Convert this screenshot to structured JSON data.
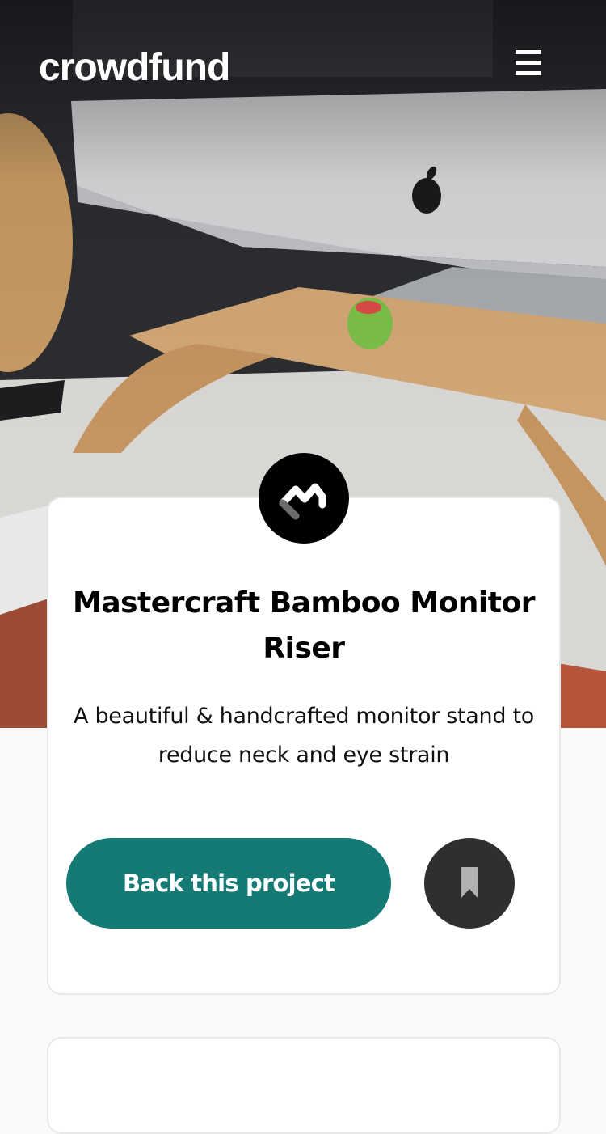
{
  "header": {
    "logo_text": "crowdfund",
    "menu_icon": "hamburger-menu-icon"
  },
  "hero": {
    "image": "monitor on bamboo riser photo"
  },
  "project": {
    "brand_icon": "mastercraft-logo-icon",
    "title": "Mastercraft Bamboo Monitor Riser",
    "description": "A beautiful & handcrafted monitor stand to reduce neck and eye strain",
    "back_button_label": "Back this project",
    "bookmark_icon": "bookmark-icon"
  },
  "colors": {
    "primary": "#147a73",
    "bookmark_bg": "#2f2f2f",
    "page_bg": "#fafafa"
  }
}
